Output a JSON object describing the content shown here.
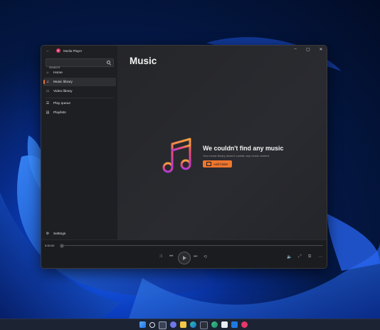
{
  "window": {
    "app_title": "Media Player",
    "controls": {
      "minimize": "–",
      "maximize": "▢",
      "close": "✕"
    }
  },
  "sidebar": {
    "search": {
      "placeholder": "Search",
      "value": ""
    },
    "items": [
      {
        "label": "Home",
        "icon": "home-icon",
        "glyph": "⌂",
        "active": false
      },
      {
        "label": "Music library",
        "icon": "music-note-icon",
        "glyph": "♫",
        "active": true
      },
      {
        "label": "Video library",
        "icon": "video-icon",
        "glyph": "▭",
        "active": false
      },
      {
        "label": "Play queue",
        "icon": "queue-icon",
        "glyph": "☰",
        "active": false
      },
      {
        "label": "Playlists",
        "icon": "playlist-icon",
        "glyph": "▤",
        "active": false
      }
    ],
    "settings_label": "Settings"
  },
  "main": {
    "title": "Music",
    "empty_state": {
      "title": "We couldn't find any music",
      "subtitle": "Your music library doesn't contain any music content.",
      "button_label": "Add folder"
    }
  },
  "player": {
    "time": "0:00:00",
    "progress": 0
  },
  "colors": {
    "accent": "#f0762e",
    "sidebar_bg": "#1e1f22",
    "main_bg": "#26272b",
    "wallpaper_blue": "#0b3fc2"
  },
  "taskbar": {
    "icons": [
      "windows-start-icon",
      "search-icon",
      "task-view-icon",
      "chat-icon",
      "file-explorer-icon",
      "edge-icon",
      "edge-beta-icon",
      "store-icon",
      "mail-icon",
      "media-player-icon"
    ]
  }
}
